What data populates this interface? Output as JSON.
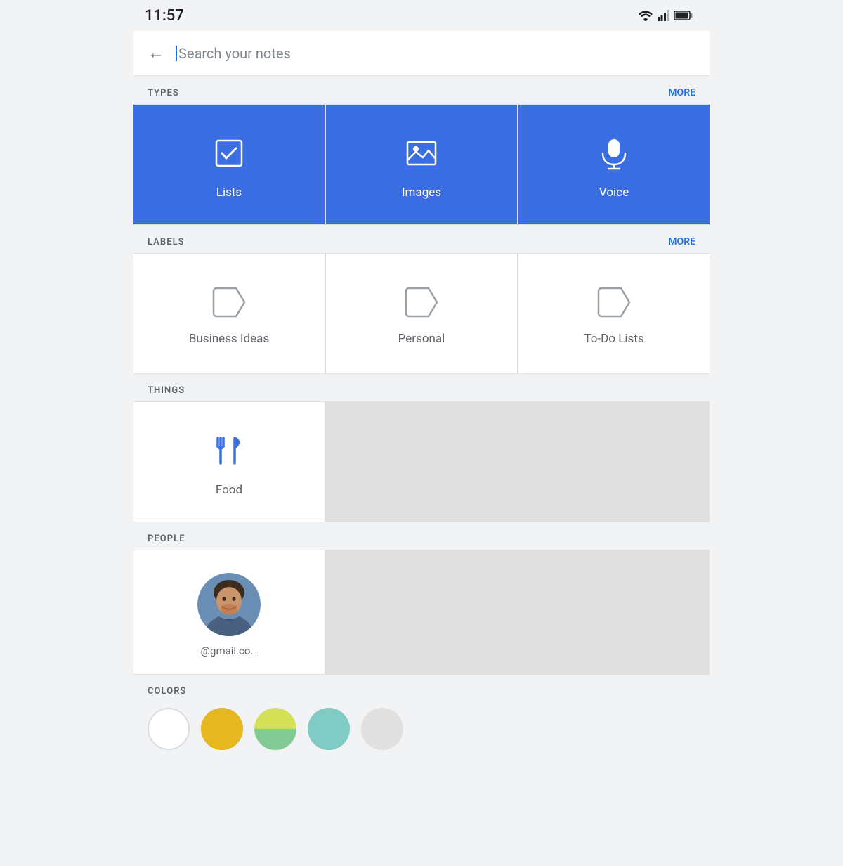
{
  "statusBar": {
    "time": "11:57"
  },
  "searchBar": {
    "placeholder": "Search your notes",
    "backArrow": "←"
  },
  "typesSection": {
    "title": "TYPES",
    "moreLabel": "MORE",
    "items": [
      {
        "id": "lists",
        "label": "Lists",
        "icon": "checkbox-icon"
      },
      {
        "id": "images",
        "label": "Images",
        "icon": "image-icon"
      },
      {
        "id": "voice",
        "label": "Voice",
        "icon": "mic-icon"
      }
    ]
  },
  "labelsSection": {
    "title": "LABELS",
    "moreLabel": "MORE",
    "items": [
      {
        "id": "business-ideas",
        "label": "Business Ideas",
        "icon": "label-tag-icon"
      },
      {
        "id": "personal",
        "label": "Personal",
        "icon": "label-tag-icon"
      },
      {
        "id": "todo-lists",
        "label": "To-Do Lists",
        "icon": "label-tag-icon"
      }
    ]
  },
  "thingsSection": {
    "title": "THINGS",
    "items": [
      {
        "id": "food",
        "label": "Food",
        "icon": "food-icon"
      }
    ]
  },
  "peopleSection": {
    "title": "PEOPLE",
    "items": [
      {
        "id": "person1",
        "email": "@gmail.co…",
        "icon": "avatar-icon"
      }
    ]
  },
  "colorsSection": {
    "title": "COLORS",
    "colors": [
      {
        "id": "white",
        "type": "white"
      },
      {
        "id": "yellow-gold",
        "type": "yellow-gold"
      },
      {
        "id": "yellow-green-teal",
        "type": "yellow-green-teal"
      },
      {
        "id": "teal",
        "type": "teal"
      },
      {
        "id": "gray",
        "type": "gray"
      }
    ]
  }
}
